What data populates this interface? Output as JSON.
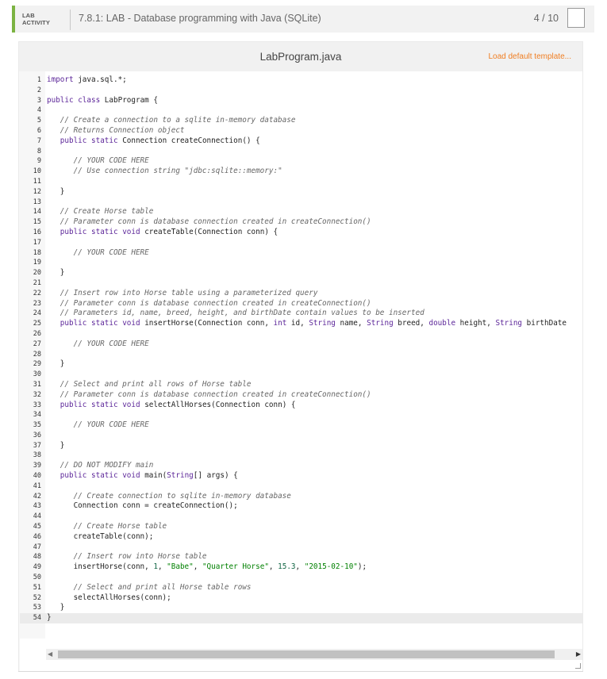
{
  "header": {
    "badge_line1": "LAB",
    "badge_line2": "ACTIVITY",
    "title": "7.8.1: LAB - Database programming with Java (SQLite)",
    "progress": "4 / 10"
  },
  "editor": {
    "filename": "LabProgram.java",
    "load_template_label": "Load default template...",
    "lines": [
      "import java.sql.*;",
      "",
      "public class LabProgram {",
      "",
      "   // Create a connection to a sqlite in-memory database",
      "   // Returns Connection object",
      "   public static Connection createConnection() {",
      "",
      "      // YOUR CODE HERE",
      "      // Use connection string \"jdbc:sqlite::memory:\"",
      "",
      "   }",
      "",
      "   // Create Horse table",
      "   // Parameter conn is database connection created in createConnection()",
      "   public static void createTable(Connection conn) {",
      "",
      "      // YOUR CODE HERE",
      "",
      "   }",
      "",
      "   // Insert row into Horse table using a parameterized query",
      "   // Parameter conn is database connection created in createConnection()",
      "   // Parameters id, name, breed, height, and birthDate contain values to be inserted",
      "   public static void insertHorse(Connection conn, int id, String name, String breed, double height, String birthDate",
      "",
      "      // YOUR CODE HERE",
      "",
      "   }",
      "",
      "   // Select and print all rows of Horse table",
      "   // Parameter conn is database connection created in createConnection()",
      "   public static void selectAllHorses(Connection conn) {",
      "",
      "      // YOUR CODE HERE",
      "",
      "   }",
      "",
      "   // DO NOT MODIFY main",
      "   public static void main(String[] args) {",
      "",
      "      // Create connection to sqlite in-memory database",
      "      Connection conn = createConnection();",
      "",
      "      // Create Horse table",
      "      createTable(conn);",
      "",
      "      // Insert row into Horse table",
      "      insertHorse(conn, 1, \"Babe\", \"Quarter Horse\", 15.3, \"2015-02-10\");",
      "",
      "      // Select and print all Horse table rows",
      "      selectAllHorses(conn);",
      "   }",
      "}"
    ],
    "active_line": 54
  },
  "colors": {
    "keyword": "#5c2699",
    "comment": "#666666",
    "string": "#008000",
    "number": "#116644",
    "accent_green": "#7cb342",
    "link_orange": "#f07e22"
  }
}
